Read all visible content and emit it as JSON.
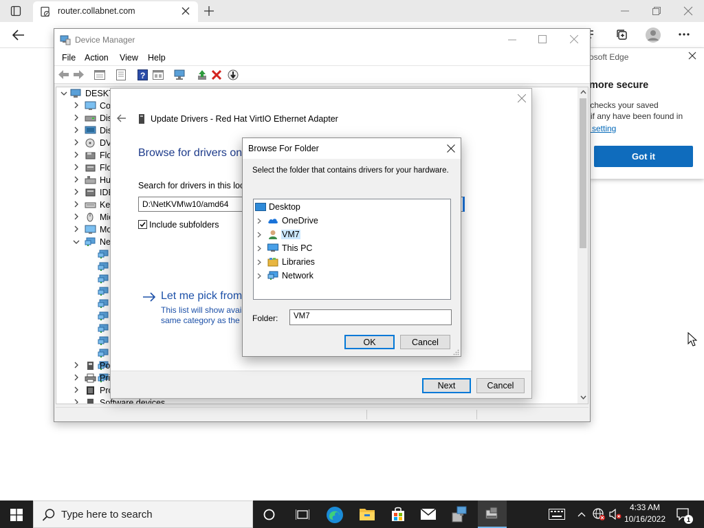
{
  "browser": {
    "tab_title": "router.collabnet.com",
    "popup": {
      "title_partial": "osoft Edge",
      "heading_partial": "more secure",
      "body_lines": [
        "y checks your saved",
        "u if any have been found in"
      ],
      "link_partial": "is setting",
      "button": "Got it"
    }
  },
  "device_manager": {
    "title": "Device Manager",
    "menu": [
      "File",
      "Action",
      "View",
      "Help"
    ],
    "tree": {
      "root": "DESKTO",
      "items": [
        "Cor",
        "Disk",
        "Disp",
        "DVD",
        "Flop",
        "Flop",
        "Hun",
        "IDE",
        "Key",
        "Mic",
        "Mo",
        "Net"
      ],
      "bottom_items": [
        "Por",
        "Prin",
        "Pro",
        "Software devices"
      ]
    }
  },
  "update_wizard": {
    "title": "Update Drivers - Red Hat VirtIO Ethernet Adapter",
    "heading": "Browse for drivers on",
    "search_label": "Search for drivers in this loca",
    "path_value": "D:\\NetKVM\\w10/amd64",
    "include_subfolders": "Include subfolders",
    "pick_title": "Let me pick from",
    "pick_desc_lines": [
      "This list will show avail",
      "same category as the d"
    ],
    "next_button": "Next",
    "cancel_button": "Cancel"
  },
  "browse_folder": {
    "title": "Browse For Folder",
    "instruction": "Select the folder that contains drivers for your hardware.",
    "tree": [
      "Desktop",
      "OneDrive",
      "VM7",
      "This PC",
      "Libraries",
      "Network"
    ],
    "selected": "VM7",
    "folder_label": "Folder:",
    "folder_value": "VM7",
    "ok_button": "OK",
    "cancel_button": "Cancel"
  },
  "taskbar": {
    "search_placeholder": "Type here to search",
    "time": "4:33 AM",
    "date": "10/16/2022",
    "notification_count": "1"
  },
  "colors": {
    "accent": "#0078d7",
    "link_blue": "#1c50a8",
    "edge_button": "#0f6cbd",
    "taskbar": "#1f1f1f"
  }
}
